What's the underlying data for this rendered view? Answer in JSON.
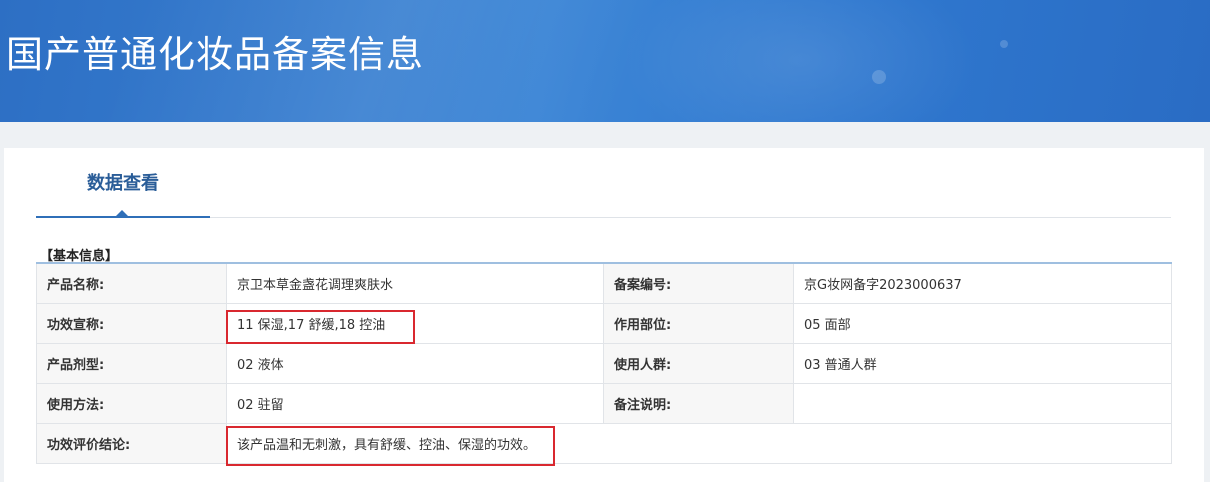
{
  "banner": {
    "title": "国产普通化妆品备案信息"
  },
  "tabs": [
    {
      "label": "数据查看"
    }
  ],
  "section": {
    "title": "【基本信息】"
  },
  "info": {
    "product_name_label": "产品名称:",
    "product_name": "京卫本草金盏花调理爽肤水",
    "record_no_label": "备案编号:",
    "record_no": "京G妆网备字2023000637",
    "efficacy_label": "功效宣称:",
    "efficacy": "11 保湿,17 舒缓,18 控油",
    "area_label": "作用部位:",
    "area": "05 面部",
    "dosage_label": "产品剂型:",
    "dosage": "02 液体",
    "population_label": "使用人群:",
    "population": "03 普通人群",
    "usage_label": "使用方法:",
    "usage": "02 驻留",
    "remarks_label": "备注说明:",
    "remarks": "",
    "conclusion_label": "功效评价结论:",
    "conclusion": "该产品温和无刺激，具有舒缓、控油、保湿的功效。"
  },
  "colors": {
    "banner": "#3d86d6",
    "tab_accent": "#2f6fb8",
    "highlight_box": "#d9282f"
  }
}
